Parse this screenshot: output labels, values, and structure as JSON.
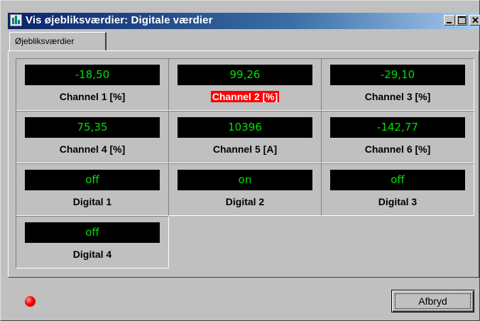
{
  "window": {
    "title": "Vis øjebliksværdier: Digitale værdier"
  },
  "tabs": [
    {
      "label": "Øjebliksværdier"
    }
  ],
  "cells": [
    {
      "value": "-18,50",
      "label": "Channel 1 [%]",
      "highlight": false
    },
    {
      "value": "99,26",
      "label": "Channel 2 [%]",
      "highlight": true
    },
    {
      "value": "-29,10",
      "label": "Channel 3 [%]",
      "highlight": false
    },
    {
      "value": "75,35",
      "label": "Channel 4 [%]",
      "highlight": false
    },
    {
      "value": "10396",
      "label": "Channel 5 [A]",
      "highlight": false
    },
    {
      "value": "-142,77",
      "label": "Channel 6 [%]",
      "highlight": false
    },
    {
      "value": "off",
      "label": "Digital 1",
      "highlight": false
    },
    {
      "value": "on",
      "label": "Digital 2",
      "highlight": false
    },
    {
      "value": "off",
      "label": "Digital 3",
      "highlight": false
    },
    {
      "value": "off",
      "label": "Digital 4",
      "highlight": false
    }
  ],
  "status": {
    "indicator_color": "#ff0000"
  },
  "buttons": {
    "abort_label": "Afbryd"
  },
  "colors": {
    "lcd_text": "#00e000",
    "lcd_background": "#000000",
    "highlight_background": "#ff0000"
  }
}
